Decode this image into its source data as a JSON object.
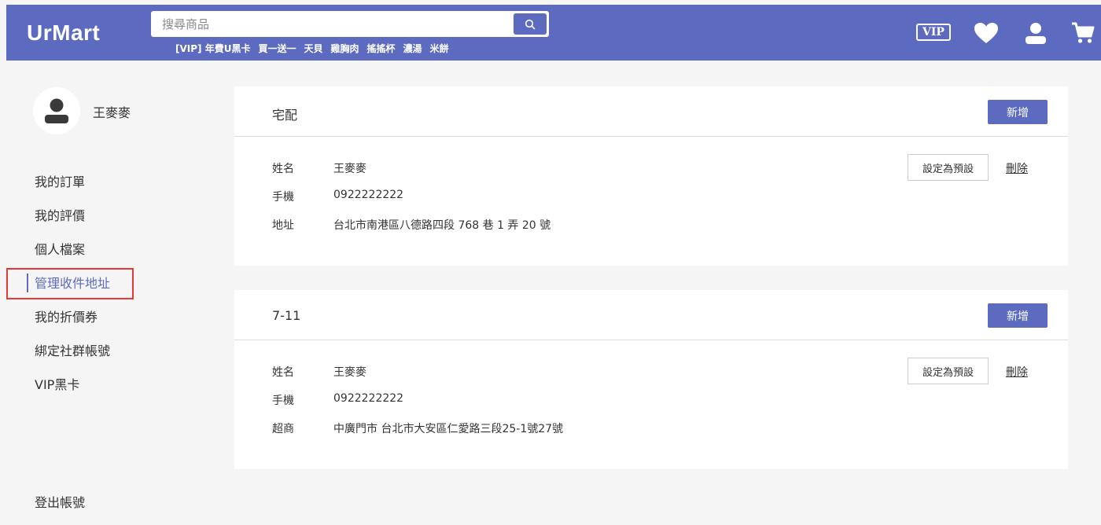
{
  "header": {
    "logo": "UrMart",
    "hot_keywords": [
      "[VIP] 年費U黑卡",
      "買一送一",
      "天貝",
      "雞胸肉",
      "搖搖杯",
      "濃湯",
      "米餅"
    ],
    "vip_label": "VIP",
    "brand_color": "#5c6bc0"
  },
  "search": {
    "placeholder": "搜尋商品"
  },
  "user": {
    "name": "王麥麥"
  },
  "sidebar": {
    "items": [
      {
        "label": "我的訂單",
        "active": false
      },
      {
        "label": "我的評價",
        "active": false
      },
      {
        "label": "個人檔案",
        "active": false
      },
      {
        "label": "管理收件地址",
        "active": true
      },
      {
        "label": "我的折價券",
        "active": false
      },
      {
        "label": "綁定社群帳號",
        "active": false
      },
      {
        "label": "VIP黑卡",
        "active": false
      }
    ],
    "logout_label": "登出帳號"
  },
  "sections": [
    {
      "title": "宅配",
      "add_label": "新增",
      "fields": [
        {
          "label": "姓名",
          "value": "王麥麥"
        },
        {
          "label": "手機",
          "value": "0922222222"
        },
        {
          "label": "地址",
          "value": "台北市南港區八德路四段 768 巷 1 弄 20 號"
        }
      ],
      "set_default_label": "設定為預設",
      "delete_label": "刪除"
    },
    {
      "title": "7-11",
      "add_label": "新增",
      "fields": [
        {
          "label": "姓名",
          "value": "王麥麥"
        },
        {
          "label": "手機",
          "value": "0922222222"
        },
        {
          "label": "超商",
          "value": "中廣門市 台北市大安區仁愛路三段25-1號27號"
        }
      ],
      "set_default_label": "設定為預設",
      "delete_label": "刪除"
    }
  ]
}
